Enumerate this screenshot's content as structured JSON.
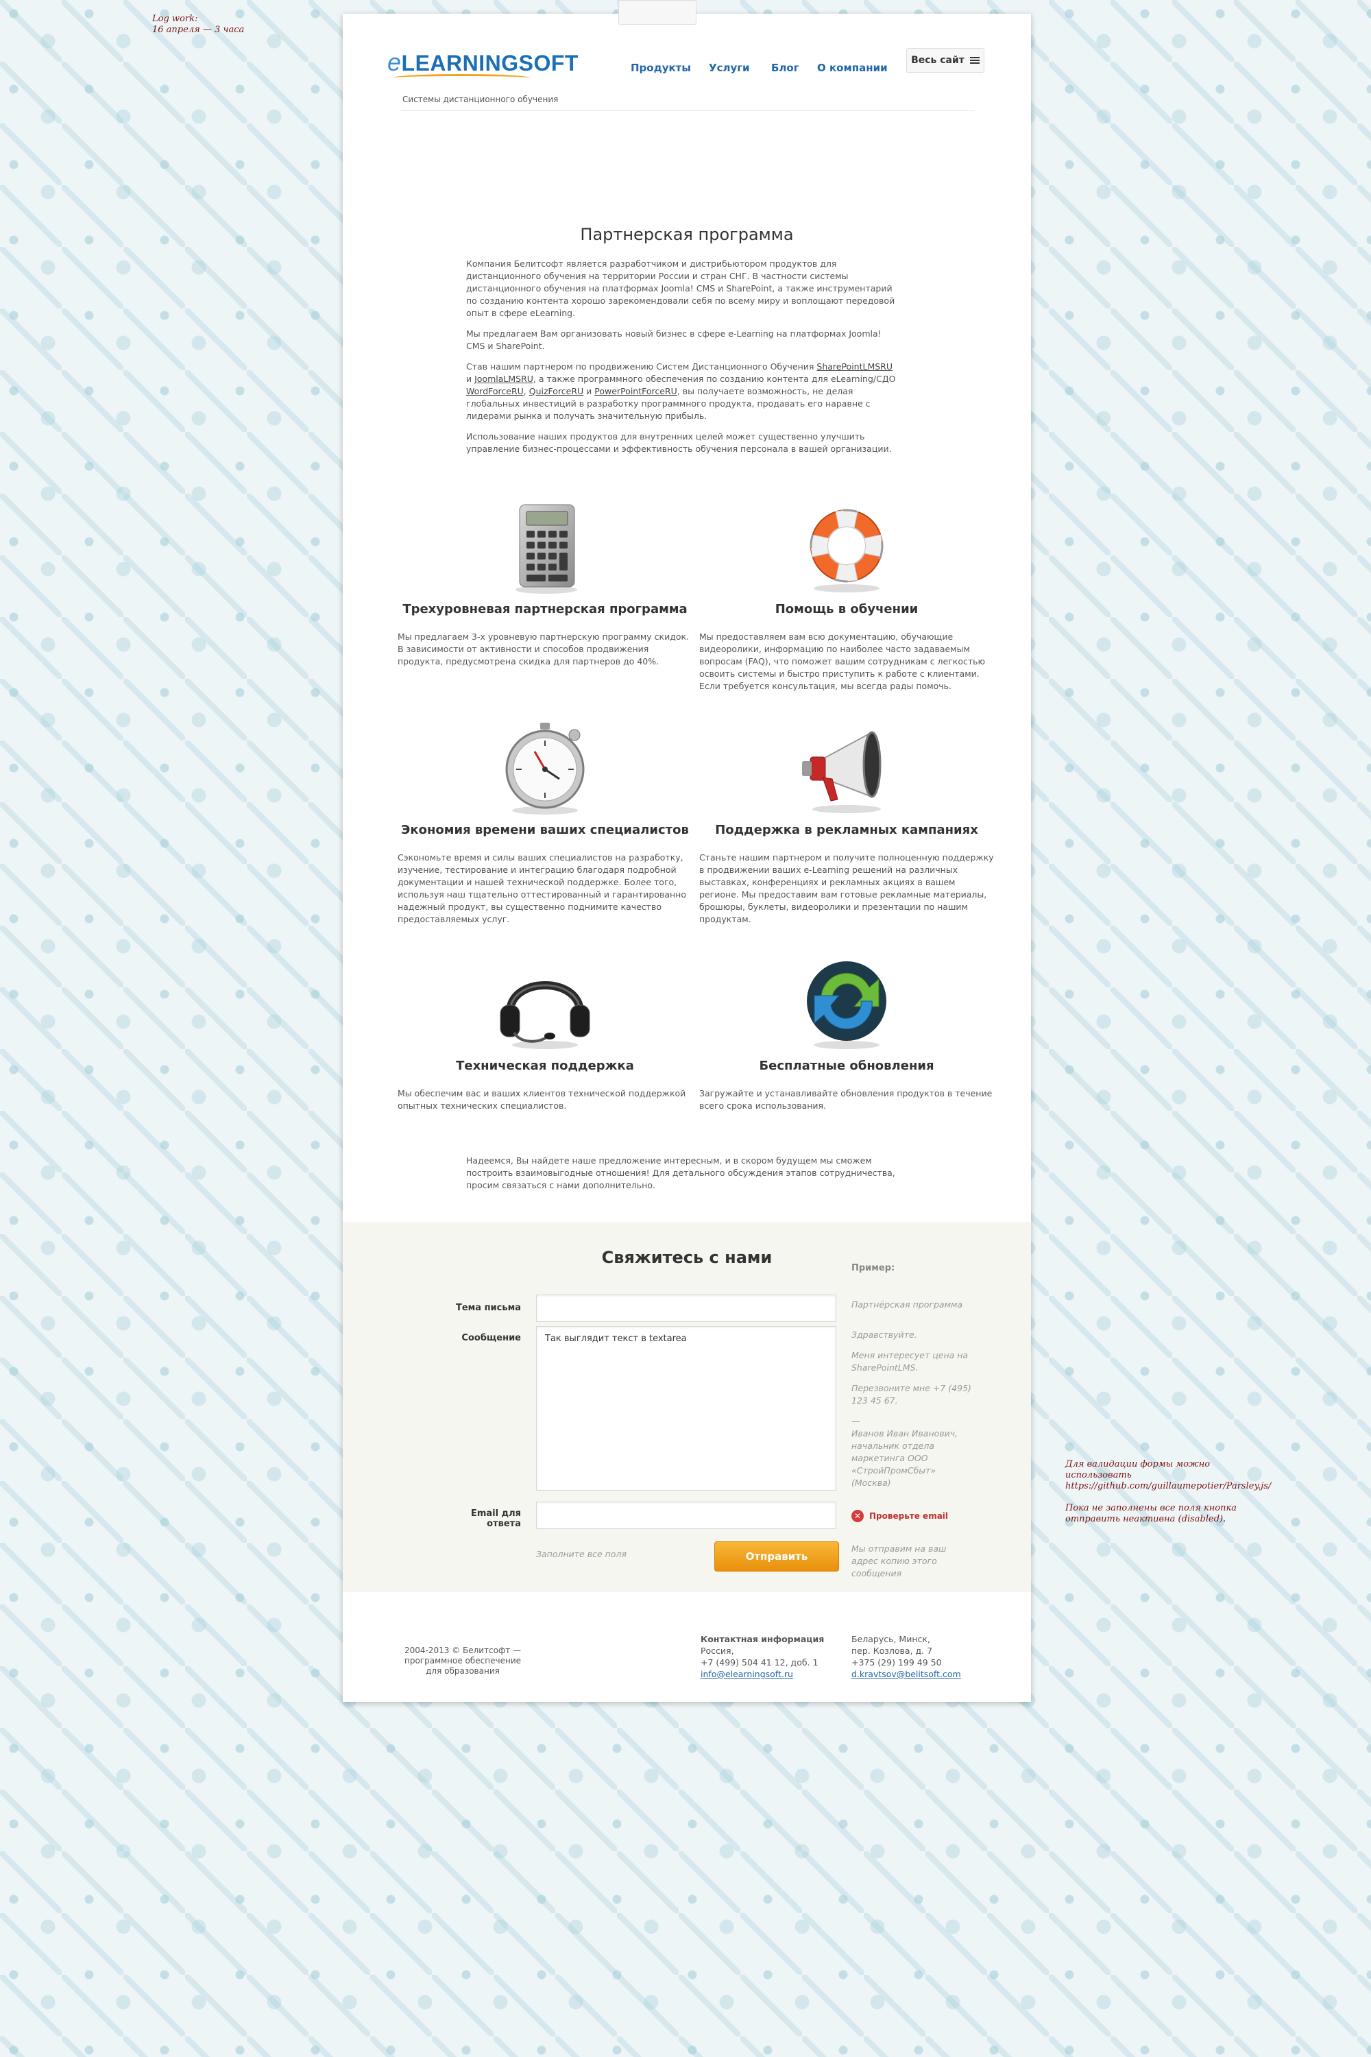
{
  "notes": {
    "log_line1": "Log work:",
    "log_line2": "16 апреля — 3 часа",
    "validation_line1": "Для валидации формы можно",
    "validation_line2": "использовать",
    "validation_line3": "https://github.com/guillaumepotier/Parsley.js/",
    "validation_line4": "Пока не заполнены все поля кнопка",
    "validation_line5": "отправить неактивна (disabled)."
  },
  "header": {
    "logo_e": "e",
    "logo_rest": "LEARNINGSOFT",
    "tagline": "Системы дистанционного обучения",
    "nav": [
      "Продукты",
      "Услуги",
      "Блог",
      "О компании"
    ],
    "site_button": "Весь сайт"
  },
  "page_title": "Партнерская программа",
  "intro": {
    "p1": "Компания Белитсофт является разработчиком и дистрибьютором продуктов для дистанционного обучения на территории России и стран СНГ. В частности системы дистанционного обучения на платформах Joomla! CMS и SharePoint, а также инструментарий по созданию контента хорошо зарекомендовали себя по всему миру и воплощают передовой опыт в сфере eLearning.",
    "p2": "Мы предлагаем Вам организовать новый бизнес в сфере e-Learning на платформах Joomla! CMS и SharePoint.",
    "p3_a": "Став нашим партнером по продвижению Систем Дистанционного Обучения ",
    "p3_link1": "SharePointLMSRU",
    "p3_b": " и ",
    "p3_link2": "JoomlaLMSRU",
    "p3_c": ", а также программного обеспечения по созданию контента для eLearning/СДО ",
    "p3_link3": "WordForceRU",
    "p3_d": ", ",
    "p3_link4": "QuizForceRU",
    "p3_e": " и ",
    "p3_link5": "PowerPointForceRU",
    "p3_f": ",  вы получаете возможность, не делая глобальных инвестиций в разработку программного продукта, продавать его наравне с лидерами рынка и получать значительную прибыль.",
    "p4": "Использование наших продуктов для внутренних целей может существенно улучшить управление бизнес-процессами и эффективность обучения персонала в вашей организации."
  },
  "features": [
    {
      "icon": "calculator-icon",
      "title": "Трехуровневая партнерская программа",
      "text": "Мы предлагаем 3-х уровневую партнерскую программу скидок. В зависимости от активности и способов продвижения продукта, предусмотрена скидка для партнеров до 40%."
    },
    {
      "icon": "lifebuoy-icon",
      "title": "Помощь в обучении",
      "text": "Мы предоставляем вам всю документацию, обучающие видеоролики, информацию по наиболее часто задаваемым вопросам (FAQ), что поможет вашим сотрудникам с легкостью освоить системы и быстро приступить к работе с клиентами. Если требуется консультация, мы всегда рады помочь."
    },
    {
      "icon": "stopwatch-icon",
      "title": "Экономия времени ваших специалистов",
      "text": "Сэкономьте время и силы ваших специалистов на разработку, изучение, тестирование и интеграцию благодаря  подробной документации и нашей технической поддержке. Более того, используя наш тщательно оттестированный и гарантированно надежный продукт, вы существенно поднимите качество предоставляемых услуг."
    },
    {
      "icon": "megaphone-icon",
      "title": "Поддержка в рекламных кампаниях",
      "text": "Станьте нашим партнером и  получите полноценную поддержку в продвижении ваших e-Learning решений на различных выставках, конференциях и рекламных акциях в вашем регионе. Мы предоставим вам готовые рекламные материалы, брошюры, буклеты, видеоролики и презентации по нашим продуктам."
    },
    {
      "icon": "headset-icon",
      "title": "Техническая поддержка",
      "text": "Мы обеспечим вас и ваших клиентов технической поддержкой опытных технических специалистов."
    },
    {
      "icon": "update-arrows-icon",
      "title": "Бесплатные обновления",
      "text": "Загружайте и устанавливайте обновления продуктов в течение всего срока использования."
    }
  ],
  "closing": "Надеемся, Вы найдете наше предложение интересным, и в скором будущем мы сможем построить взаимовыгодные отношения! Для детального обсуждения этапов сотрудничества, просим связаться с нами дополнительно.",
  "contact": {
    "title": "Свяжитесь с нами",
    "subject_label": "Тема письма",
    "subject_value": "",
    "message_label": "Сообщение",
    "message_value": "Так выглядит текст в textarea",
    "email_label": "Email для ответа",
    "email_value": "",
    "example_title": "Пример:",
    "example_subject": "Партнёрская программа",
    "example_msg1": "Здравствуйте.",
    "example_msg2": "Меня интересует цена на SharePointLMS.",
    "example_msg3": "Перезвоните мне +7 (495) 123 45 67.",
    "example_msg4": "—",
    "example_msg5": "Иванов Иван Иванович, начальник отдела маркетинга ООО «СтройПромСбыт» (Москва)",
    "error_text": "Проверьте email",
    "fill_all_hint": "Заполните все поля",
    "send_button": "Отправить",
    "copy_hint": "Мы отправим на ваш адрес копию этого сообщения"
  },
  "footer": {
    "copyright": "2004-2013 © Белитсофт — программное обеспечение для образования",
    "contact_title": "Контактная информация",
    "ru_country": "Россия,",
    "ru_phone": "+7 (499) 504 41 12, доб. 1",
    "ru_email": "info@elearningsoft.ru",
    "by_address1": "Беларусь, Минск,",
    "by_address2": "пер. Козлова, д. 7",
    "by_phone": "+375 (29) 199 49 50",
    "by_email": "d.kravtsov@belitsoft.com"
  }
}
